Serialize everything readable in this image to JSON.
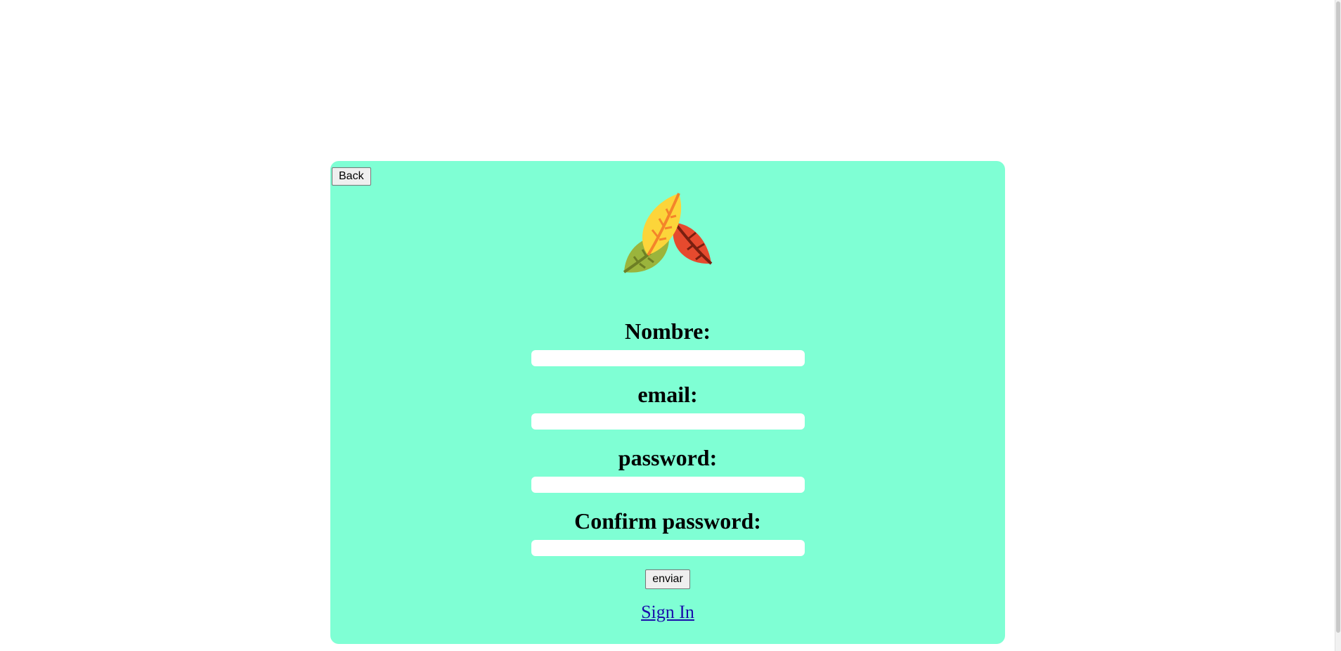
{
  "back_button": {
    "label": "Back"
  },
  "logo": {
    "icon": "leaves-logo-icon"
  },
  "form": {
    "fields": [
      {
        "label": "Nombre:",
        "value": "",
        "placeholder": ""
      },
      {
        "label": "email:",
        "value": "",
        "placeholder": ""
      },
      {
        "label": "password:",
        "value": "",
        "placeholder": ""
      },
      {
        "label": "Confirm password:",
        "value": "",
        "placeholder": ""
      }
    ],
    "submit_label": "enviar"
  },
  "signin_link": "Sign In",
  "colors": {
    "card_background": "#7fffd4",
    "page_background": "#ffffff",
    "link": "#1a0dab"
  }
}
